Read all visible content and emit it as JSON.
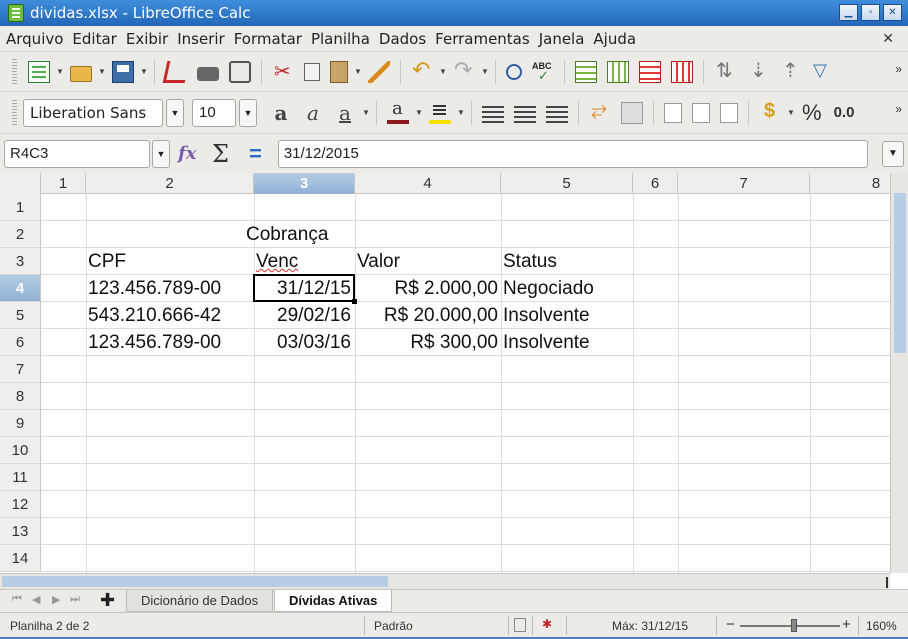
{
  "window": {
    "title": "dividas.xlsx - LibreOffice Calc",
    "controls": [
      "▁",
      "▫",
      "✕"
    ]
  },
  "menu": {
    "items": [
      "Arquivo",
      "Editar",
      "Exibir",
      "Inserir",
      "Formatar",
      "Planilha",
      "Dados",
      "Ferramentas",
      "Janela",
      "Ajuda"
    ],
    "close_glyph": "✕"
  },
  "format_toolbar": {
    "font_name": "Liberation Sans",
    "font_size": "10",
    "bold_glyph": "a",
    "italic_glyph": "a",
    "underline_glyph": "a",
    "percent": "%",
    "decimal": "0.0"
  },
  "formula_bar": {
    "name_box": "R4C3",
    "sum_glyph": "Σ",
    "equals_glyph": "=",
    "content": "31/12/2015"
  },
  "grid": {
    "columns": [
      "1",
      "2",
      "3",
      "4",
      "5",
      "6",
      "7",
      "8"
    ],
    "selected_column": "3",
    "rows": [
      "1",
      "2",
      "3",
      "4",
      "5",
      "6",
      "7",
      "8",
      "9",
      "10",
      "11",
      "12",
      "13",
      "14"
    ],
    "selected_row": "4",
    "title": "Cobrança",
    "headers": {
      "cpf": "CPF",
      "venc": "Venc",
      "valor": "Valor",
      "status": "Status"
    },
    "data_rows": [
      {
        "cpf": "123.456.789-00",
        "venc": "31/12/15",
        "valor": "R$ 2.000,00",
        "status": "Negociado"
      },
      {
        "cpf": "543.210.666-42",
        "venc": "29/02/16",
        "valor": "R$ 20.000,00",
        "status": "Insolvente"
      },
      {
        "cpf": "123.456.789-00",
        "venc": "03/03/16",
        "valor": "R$ 300,00",
        "status": "Insolvente"
      }
    ]
  },
  "sheet_tabs": {
    "tabs": [
      "Dicionário de Dados",
      "Dívidas Ativas"
    ],
    "active": "Dívidas Ativas",
    "add_glyph": "✚"
  },
  "status_bar": {
    "sheet_info": "Planilha 2 de 2",
    "page_style": "Padrão",
    "summary": "Máx: 31/12/15",
    "zoom_minus": "−",
    "zoom_plus": "+",
    "zoom": "160%"
  }
}
